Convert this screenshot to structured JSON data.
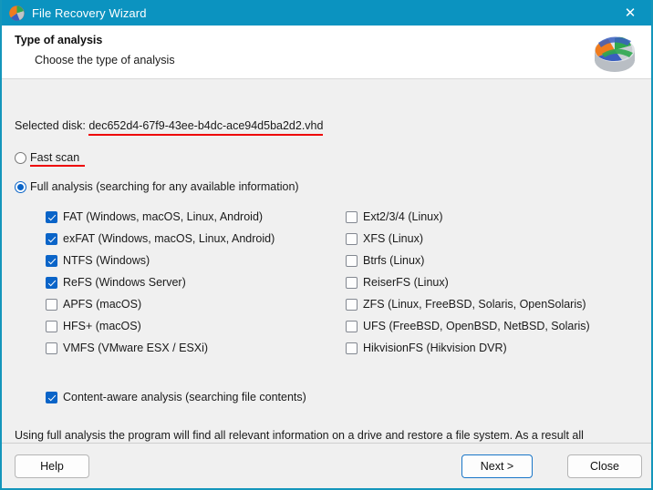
{
  "window": {
    "title": "File Recovery Wizard",
    "title_icon": "disk-pie-icon",
    "close_icon": "close-icon",
    "titlebar_color": "#0b93c0",
    "border_color": "#1496bb",
    "accent_color": "#0a64c8",
    "annotation_color": "#ee0000",
    "body_background": "#f0f0f0"
  },
  "header": {
    "title": "Type of analysis",
    "subtitle": "Choose the type of analysis",
    "logo_icon": "recovery-disk-logo-icon"
  },
  "disk": {
    "label": "Selected disk:",
    "name": "dec652d4-67f9-43ee-b4dc-ace94d5ba2d2.vhd",
    "name_underlined": true
  },
  "scan_mode": {
    "options": [
      {
        "label": "Fast scan",
        "checked": false,
        "underlined": true
      },
      {
        "label": "Full analysis (searching for any available information)",
        "checked": false,
        "underlined": false
      }
    ],
    "selected": "Full analysis (searching for any available information)"
  },
  "filesystems": {
    "left_column": [
      {
        "label": "FAT (Windows, macOS, Linux, Android)",
        "checked": true
      },
      {
        "label": "exFAT (Windows, macOS, Linux, Android)",
        "checked": true
      },
      {
        "label": "NTFS (Windows)",
        "checked": true
      },
      {
        "label": "ReFS (Windows Server)",
        "checked": true
      },
      {
        "label": "APFS (macOS)",
        "checked": false
      },
      {
        "label": "HFS+ (macOS)",
        "checked": false
      },
      {
        "label": "VMFS (VMware ESX / ESXi)",
        "checked": false
      }
    ],
    "right_column": [
      {
        "label": "Ext2/3/4 (Linux)",
        "checked": false
      },
      {
        "label": "XFS (Linux)",
        "checked": false
      },
      {
        "label": "Btrfs (Linux)",
        "checked": false
      },
      {
        "label": "ReiserFS (Linux)",
        "checked": false
      },
      {
        "label": "ZFS (Linux, FreeBSD, Solaris, OpenSolaris)",
        "checked": false
      },
      {
        "label": "UFS (FreeBSD, OpenBSD, NetBSD, Solaris)",
        "checked": false
      },
      {
        "label": "HikvisionFS (Hikvision DVR)",
        "checked": false
      }
    ]
  },
  "content_aware": {
    "label": "Content-aware analysis (searching file contents)",
    "checked": true
  },
  "note": "Using full analysis the program will find all relevant information on a drive and restore a file system. As a result all relevant files will be restored.",
  "footer": {
    "help_label": "Help",
    "next_label": "Next >",
    "close_label": "Close",
    "default_button": "Next >"
  }
}
